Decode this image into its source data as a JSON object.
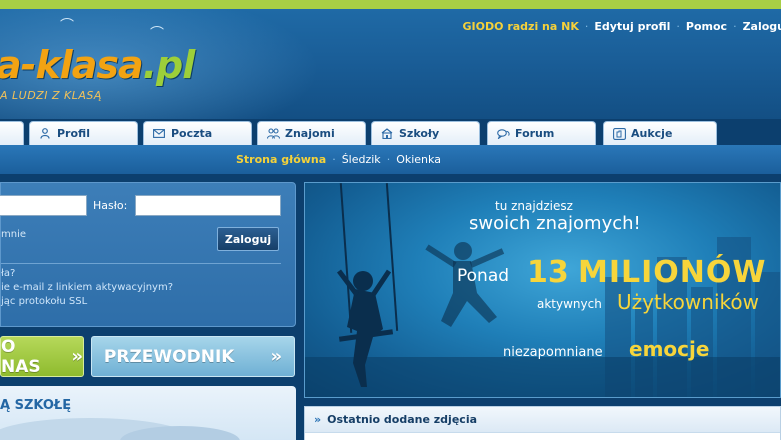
{
  "brand": {
    "logo_main": "a-klasa",
    "logo_tld": ".pl",
    "slogan": "A LUDZI Z KLASĄ"
  },
  "top_links": [
    {
      "label": "GIODO radzi na NK"
    },
    {
      "label": "Edytuj profil"
    },
    {
      "label": "Pomoc"
    },
    {
      "label": "Zalogu"
    }
  ],
  "tabs": [
    {
      "label": "Profil",
      "icon": "person-icon"
    },
    {
      "label": "Poczta",
      "icon": "mail-icon"
    },
    {
      "label": "Znajomi",
      "icon": "friends-icon"
    },
    {
      "label": "Szkoły",
      "icon": "school-icon"
    },
    {
      "label": "Forum",
      "icon": "forum-icon"
    },
    {
      "label": "Aukcje",
      "icon": "auction-icon"
    }
  ],
  "subnav": {
    "active": "Strona główna",
    "items": [
      "Śledzik",
      "Okienka"
    ]
  },
  "login": {
    "password_label": "Hasło:",
    "remember_label": "mnie",
    "submit_label": "Zaloguj",
    "links": [
      "ła?",
      "ie e-mail z linkiem aktywacyjnym?",
      "jąc protokołu SSL"
    ]
  },
  "buttons": {
    "onas": "O NAS",
    "onas_arrow": "»",
    "przewodnik": "PRZEWODNIK",
    "przewodnik_arrow": "»"
  },
  "school": {
    "title": "Ą SZKOŁĘ"
  },
  "banner": {
    "line1": "tu znajdziesz",
    "line2": "swoich znajomych!",
    "line3_pre": "Ponad",
    "line3_num": "13",
    "line3_word": "MILIONÓW",
    "line4_pre": "aktywnych",
    "line4_word": "Użytkowników",
    "line5_pre": "niezapomniane",
    "line5_word": "emocje"
  },
  "photos": {
    "chevron": "»",
    "title": "Ostatnio dodane zdjęcia"
  },
  "colors": {
    "accent_green": "#a8cf45",
    "header_blue": "#1a5e98",
    "highlight_yellow": "#f7d53b",
    "logo_orange": "#f2a313"
  }
}
